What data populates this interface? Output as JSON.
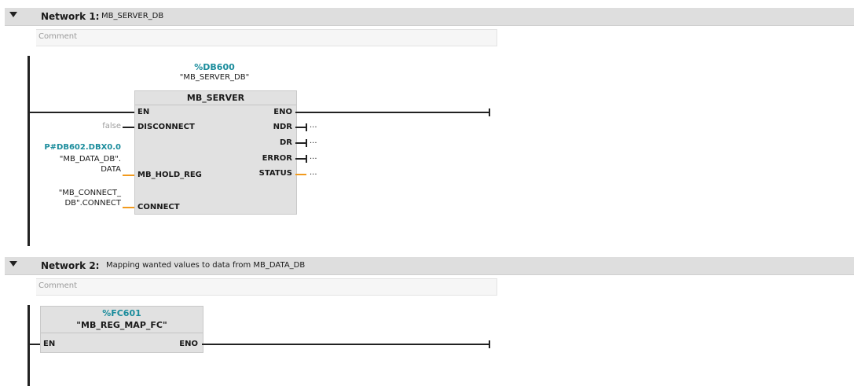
{
  "network1": {
    "label": "Network 1:",
    "title": "MB_SERVER_DB",
    "comment": "Comment",
    "block": {
      "instance_address": "%DB600",
      "instance_name": "\"MB_SERVER_DB\"",
      "type": "MB_SERVER",
      "inputs": {
        "en": "EN",
        "disconnect": "DISCONNECT",
        "mb_hold_reg": "MB_HOLD_REG",
        "connect": "CONNECT"
      },
      "outputs": {
        "eno": "ENO",
        "ndr": "NDR",
        "dr": "DR",
        "error": "ERROR",
        "status": "STATUS"
      }
    },
    "params": {
      "disconnect_value": "false",
      "hold_reg_address": "P#DB602.DBX0.0",
      "hold_reg_line1": "\"MB_DATA_DB\".",
      "hold_reg_line2": "DATA",
      "connect_line1": "\"MB_CONNECT_",
      "connect_line2": "DB\".CONNECT",
      "ellipsis": "..."
    }
  },
  "network2": {
    "label": "Network 2:",
    "title": "Mapping wanted values to data from MB_DATA_DB",
    "comment": "Comment",
    "block": {
      "address": "%FC601",
      "name": "\"MB_REG_MAP_FC\"",
      "en": "EN",
      "eno": "ENO"
    }
  },
  "colors": {
    "address_teal": "#1a8c9c",
    "wire_orange": "#f29a1d",
    "header_gray": "#dedede",
    "block_gray": "#e1e1e1"
  }
}
